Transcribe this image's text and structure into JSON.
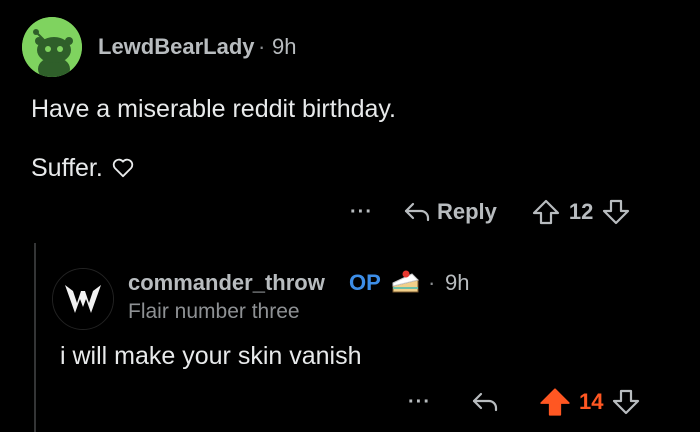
{
  "comment": {
    "username": "LewdBearLady",
    "separator": "·",
    "time": "9h",
    "lines": [
      "Have a miserable reddit birthday.",
      "Suffer."
    ],
    "heart_icon": "heart-outline-icon",
    "actions": {
      "more": "···",
      "reply_label": "Reply",
      "score": "12"
    }
  },
  "reply": {
    "username": "commander_throw",
    "op_badge": "OP",
    "cake_icon": "cake-day-icon",
    "separator": "·",
    "time": "9h",
    "flair": "Flair number three",
    "text": "i will make your skin vanish",
    "actions": {
      "more": "···",
      "score": "14"
    }
  },
  "colors": {
    "background": "#000000",
    "avatar_green": "#7fd35f",
    "op_blue": "#3d8ee8",
    "upvote_orange": "#ff5722"
  }
}
